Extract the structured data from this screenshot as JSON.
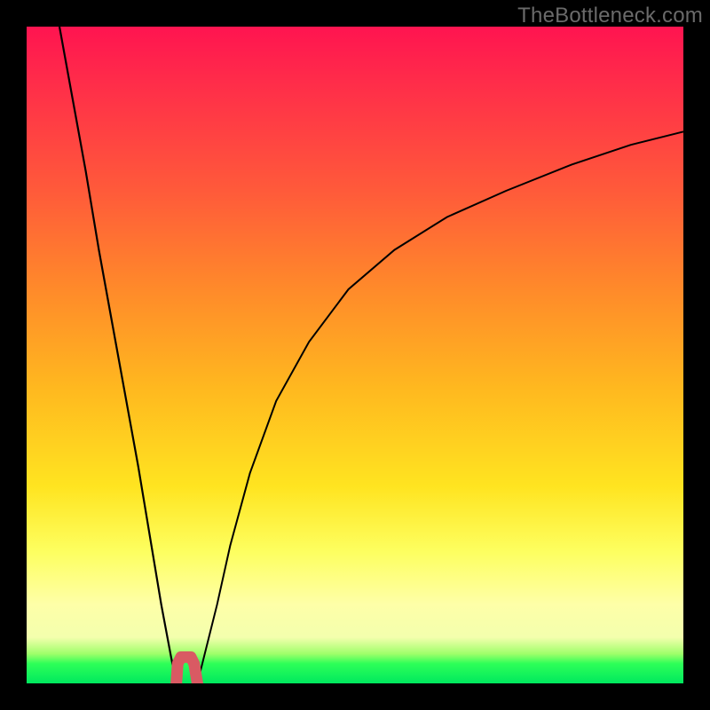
{
  "watermark": "TheBottleneck.com",
  "chart_data": {
    "type": "line",
    "title": "",
    "xlabel": "",
    "ylabel": "",
    "xlim": [
      0,
      100
    ],
    "ylim": [
      0,
      100
    ],
    "grid": false,
    "series": [
      {
        "name": "left-curve",
        "x": [
          5,
          7,
          9,
          11,
          13,
          15,
          17,
          19,
          20.5,
          22,
          22.8
        ],
        "y": [
          100,
          89,
          78,
          66,
          55,
          44,
          33,
          21,
          12,
          4,
          0
        ]
      },
      {
        "name": "right-curve",
        "x": [
          26,
          27,
          29,
          31,
          34,
          38,
          43,
          49,
          56,
          64,
          73,
          83,
          92,
          100
        ],
        "y": [
          0,
          4,
          12,
          21,
          32,
          43,
          52,
          60,
          66,
          71,
          75,
          79,
          82,
          84
        ]
      },
      {
        "name": "notch-marker",
        "x": [
          22.8,
          23,
          23.5,
          24,
          24.5,
          25,
          25.5,
          26
        ],
        "y": [
          0,
          3,
          4,
          4,
          4,
          4,
          3,
          0
        ]
      }
    ],
    "marker": {
      "shape": "u-notch",
      "color": "#d95a63",
      "x_range": [
        22.8,
        26
      ],
      "depth_pct": 4
    }
  }
}
